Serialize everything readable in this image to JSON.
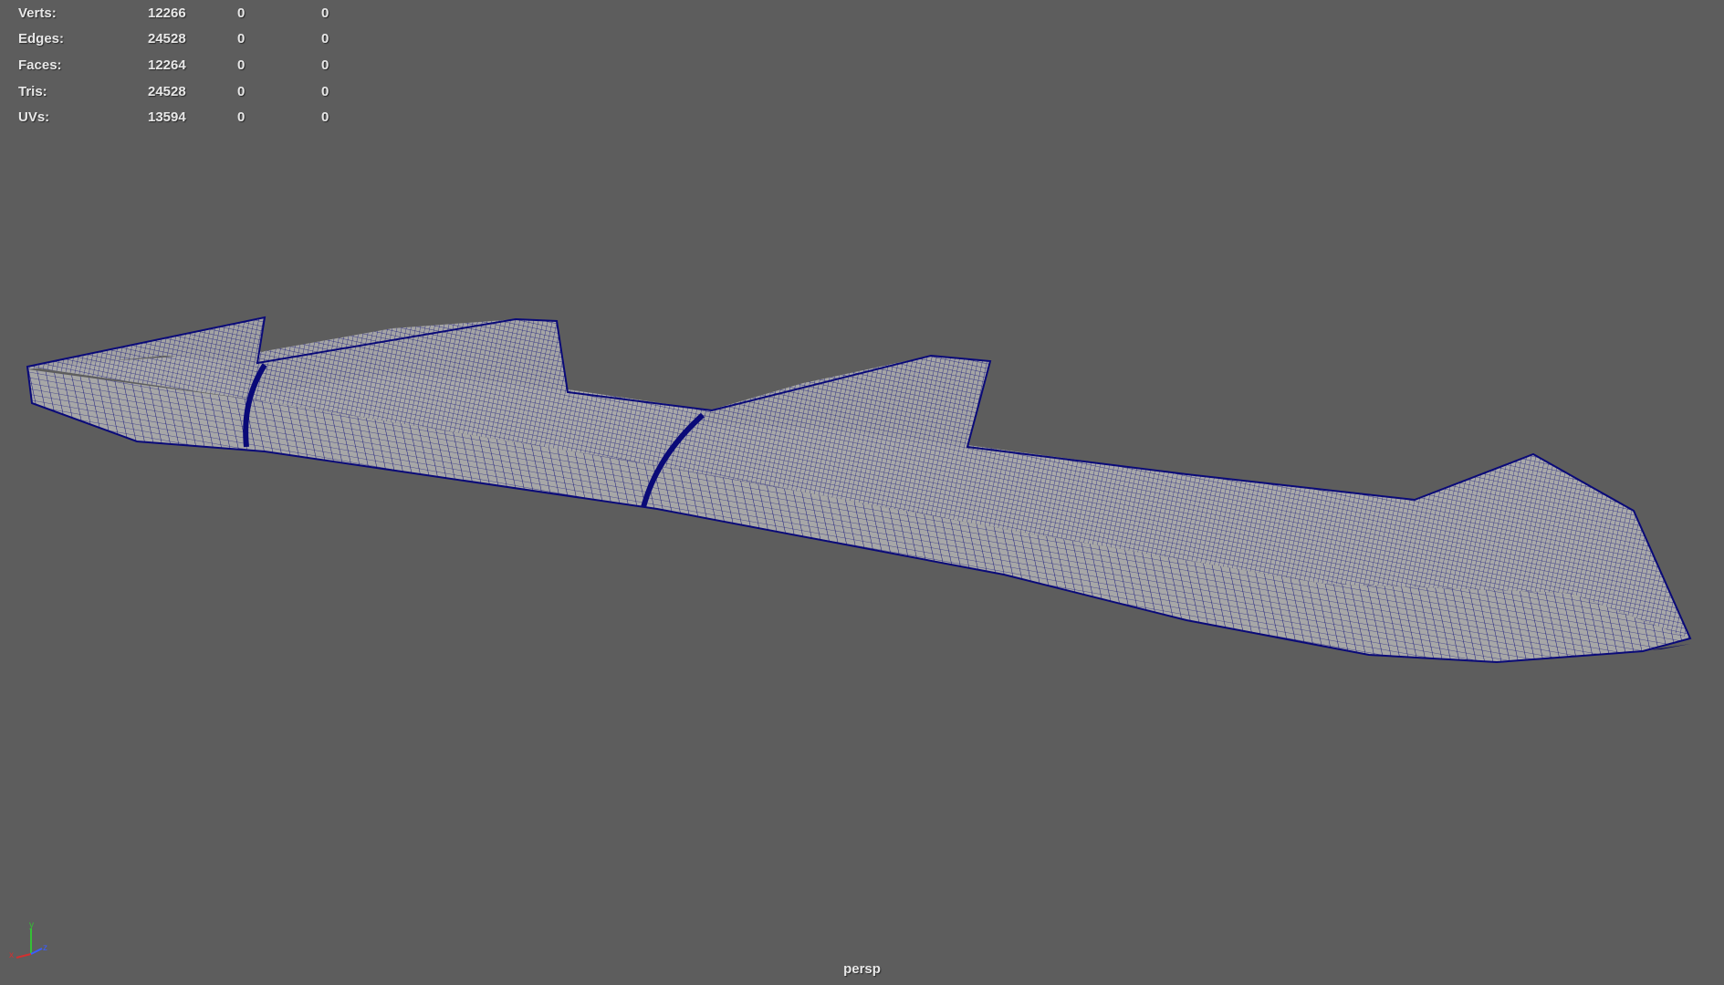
{
  "hud": {
    "rows": [
      {
        "label": "Verts:",
        "c1": "12266",
        "c2": "0",
        "c3": "0"
      },
      {
        "label": "Edges:",
        "c1": "24528",
        "c2": "0",
        "c3": "0"
      },
      {
        "label": "Faces:",
        "c1": "12264",
        "c2": "0",
        "c3": "0"
      },
      {
        "label": "Tris:",
        "c1": "24528",
        "c2": "0",
        "c3": "0"
      },
      {
        "label": "UVs:",
        "c1": "13594",
        "c2": "0",
        "c3": "0"
      }
    ]
  },
  "viewport": {
    "camera": "persp",
    "background_color": "#5d5d5d",
    "mesh_fill_color": "#a7a7a7",
    "wireframe_color": "#0a0a78"
  },
  "axis_gizmo": {
    "x_label": "x",
    "y_label": "y",
    "z_label": "z",
    "x_color": "#d23030",
    "y_color": "#34c034",
    "z_color": "#3a5cff"
  }
}
